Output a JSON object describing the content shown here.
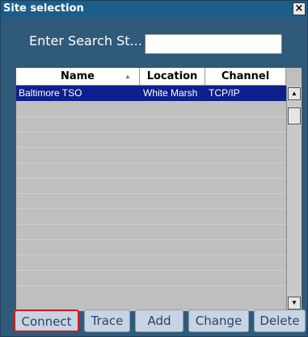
{
  "window": {
    "title": "Site selection",
    "close_symbol": "×"
  },
  "search": {
    "label": "Enter Search St...",
    "value": ""
  },
  "table": {
    "columns": [
      "Name",
      "Location",
      "Channel"
    ],
    "rows": [
      {
        "name": "Baltimore TSO",
        "location": "White Marsh",
        "channel": "TCP/IP",
        "selected": true
      }
    ]
  },
  "buttons": {
    "connect": "Connect",
    "trace": "Trace",
    "add": "Add",
    "change": "Change",
    "delete": "Delete"
  },
  "icons": {
    "sort": "sort-ascending-icon",
    "scroll_up": "scroll-up-arrow-icon",
    "scroll_down": "scroll-down-arrow-icon",
    "close": "close-icon"
  },
  "colors": {
    "dialog_background": "#2f5a7a",
    "titlebar": "#1b5e8a",
    "selected_row": "#0c1f8c",
    "highlight_border": "#d11c1c"
  }
}
